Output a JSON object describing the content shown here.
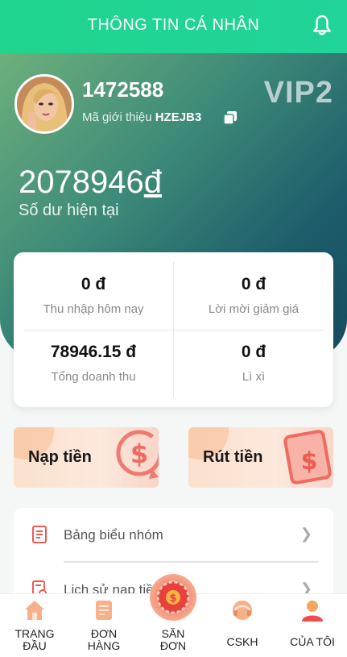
{
  "header": {
    "title": "THÔNG TIN CÁ NHÂN",
    "bell_icon": "bell-icon"
  },
  "profile": {
    "user_id": "1472588",
    "ref_label": "Mã giới thiệu",
    "ref_code": "HZEJB3",
    "vip": "VIP2"
  },
  "balance": {
    "amount": "2078946",
    "currency": "đ",
    "label": "Số dư hiện tại"
  },
  "stats": [
    {
      "value": "0 đ",
      "label": "Thu nhập hôm nay"
    },
    {
      "value": "0 đ",
      "label": "Lời mời giảm giá"
    },
    {
      "value": "78946.15 đ",
      "label": "Tổng doanh thu"
    },
    {
      "value": "0 đ",
      "label": "Lì xì"
    }
  ],
  "actions": {
    "deposit": "Nạp tiền",
    "withdraw": "Rút tiền"
  },
  "menu": [
    {
      "label": "Bảng biểu nhóm",
      "icon": "report-icon"
    },
    {
      "label": "Lịch sử nạp tiền",
      "icon": "history-icon"
    }
  ],
  "tabs": [
    {
      "label_1": "TRANG",
      "label_2": "ĐẦU",
      "icon": "home-icon"
    },
    {
      "label_1": "ĐƠN",
      "label_2": "HÀNG",
      "icon": "order-icon"
    },
    {
      "label_1": "SĂN",
      "label_2": "ĐƠN",
      "icon": "coin-icon"
    },
    {
      "label_1": "CSKH",
      "label_2": "",
      "icon": "headset-icon"
    },
    {
      "label_1": "CỦA TÔI",
      "label_2": "",
      "icon": "user-icon"
    }
  ],
  "colors": {
    "accent": "#1fd58d",
    "hero_dark": "#174c5e",
    "brand_red": "#ef4d4d"
  }
}
